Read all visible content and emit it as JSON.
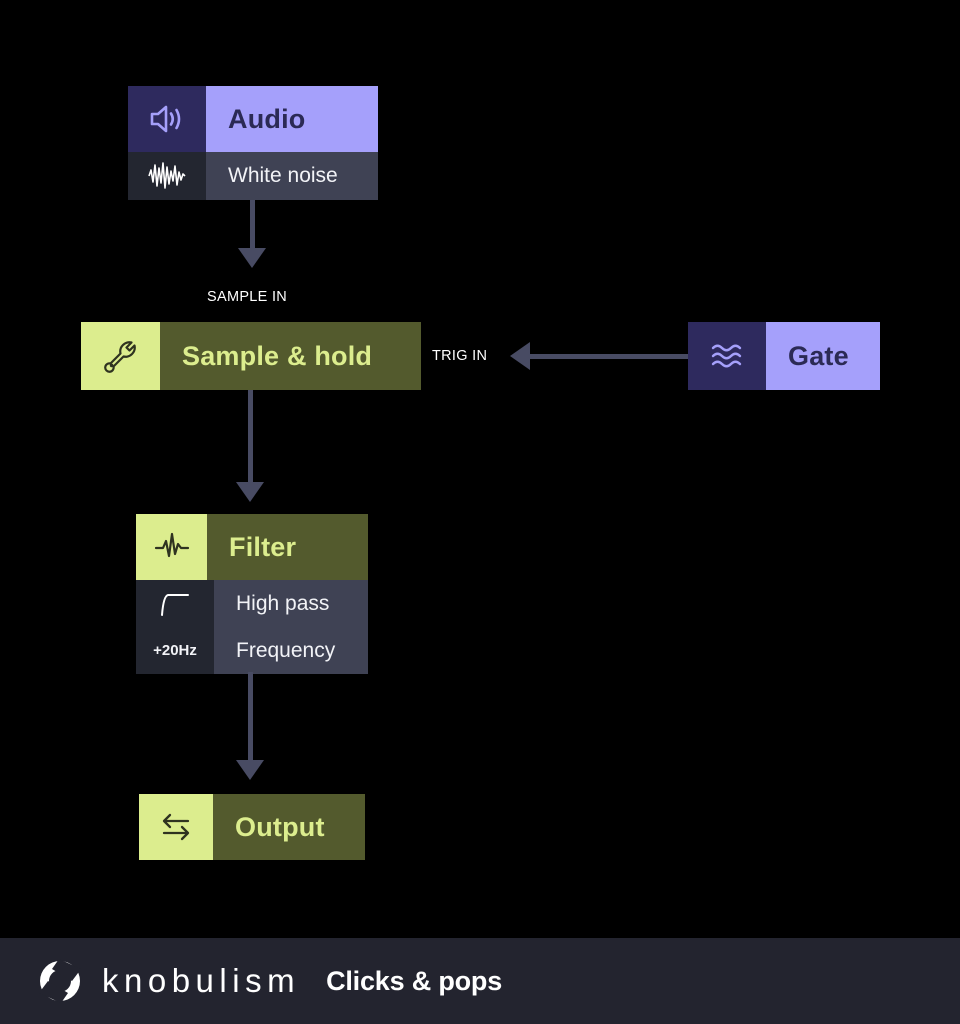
{
  "canvas": {
    "background": "#000000",
    "connector_color": "#484b63"
  },
  "modules": {
    "audio": {
      "title": "Audio",
      "icon": "speaker-icon",
      "theme": "purple",
      "accent_bg": "#a5a0fb",
      "icon_bg": "#2e2a5e",
      "title_color": "#2b2a55",
      "rows": [
        {
          "icon": "white-noise-waveform-icon",
          "label": "White noise"
        }
      ]
    },
    "sample_hold": {
      "title": "Sample & hold",
      "icon": "wrench-icon",
      "theme": "green",
      "accent_bg": "#535a2d",
      "icon_bg": "#dced8e",
      "title_color": "#dced8e",
      "rows": []
    },
    "gate": {
      "title": "Gate",
      "icon": "waves-icon",
      "theme": "purple",
      "accent_bg": "#a5a0fb",
      "icon_bg": "#2e2a5e",
      "title_color": "#2b2a55",
      "rows": []
    },
    "filter": {
      "title": "Filter",
      "icon": "spike-waveform-icon",
      "theme": "green",
      "accent_bg": "#535a2d",
      "icon_bg": "#dced8e",
      "title_color": "#dced8e",
      "rows": [
        {
          "icon": "highpass-curve-icon",
          "label": "High pass",
          "value": ""
        },
        {
          "icon": "",
          "label": "Frequency",
          "value": "+20Hz"
        }
      ]
    },
    "output": {
      "title": "Output",
      "icon": "transfer-arrows-icon",
      "theme": "green",
      "accent_bg": "#535a2d",
      "icon_bg": "#dced8e",
      "title_color": "#dced8e",
      "rows": []
    }
  },
  "ports": {
    "sample_in": "SAMPLE IN",
    "trig_in": "TRIG IN"
  },
  "footer": {
    "logo": "knob-logo-icon",
    "brand": "knobulism",
    "subtitle": "Clicks & pops",
    "background": "#23242f"
  }
}
